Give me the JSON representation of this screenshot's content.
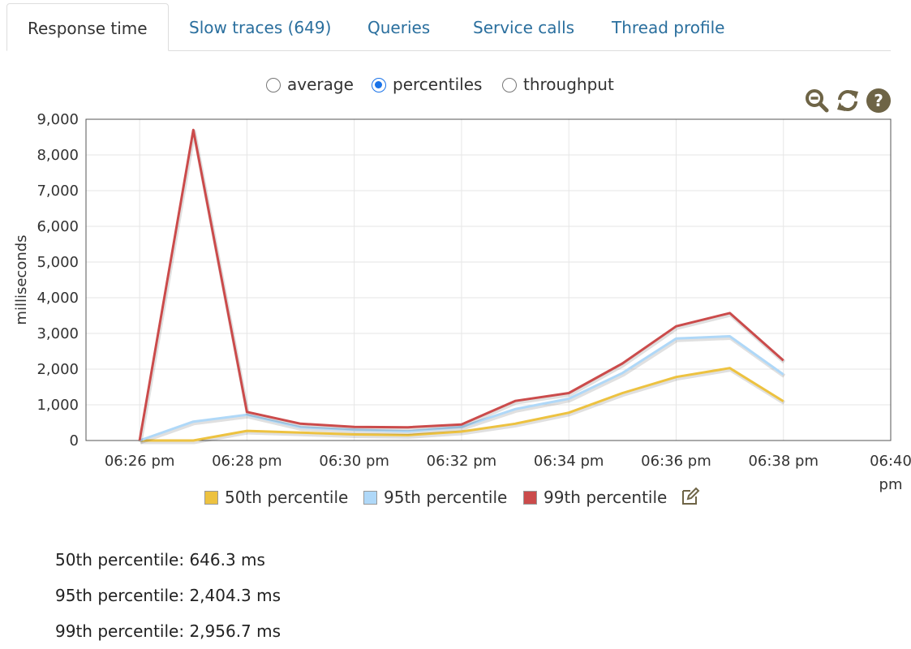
{
  "tabs": [
    {
      "label": "Response time",
      "active": true
    },
    {
      "label": "Slow traces (649)",
      "active": false
    },
    {
      "label": "Queries",
      "active": false
    },
    {
      "label": "Service calls",
      "active": false
    },
    {
      "label": "Thread profile",
      "active": false
    }
  ],
  "view_modes": {
    "options": [
      "average",
      "percentiles",
      "throughput"
    ],
    "selected": "percentiles"
  },
  "toolbar_icons": [
    "zoom-out-icon",
    "refresh-icon",
    "help-icon"
  ],
  "chart_data": {
    "type": "line",
    "title": "",
    "xlabel": "",
    "ylabel": "milliseconds",
    "x": [
      "06:26 pm",
      "06:27 pm",
      "06:28 pm",
      "06:29 pm",
      "06:30 pm",
      "06:31 pm",
      "06:32 pm",
      "06:33 pm",
      "06:34 pm",
      "06:35 pm",
      "06:36 pm",
      "06:37 pm",
      "06:38 pm"
    ],
    "x_ticks": [
      "06:26 pm",
      "06:28 pm",
      "06:30 pm",
      "06:32 pm",
      "06:34 pm",
      "06:36 pm",
      "06:38 pm",
      "06:40 pm"
    ],
    "xlim": [
      "06:25 pm",
      "06:40 pm"
    ],
    "ylim": [
      0,
      9000
    ],
    "y_ticks": [
      "0",
      "1,000",
      "2,000",
      "3,000",
      "4,000",
      "5,000",
      "6,000",
      "7,000",
      "8,000",
      "9,000"
    ],
    "grid": true,
    "legend_position": "bottom",
    "series": [
      {
        "name": "50th percentile",
        "color": "#edc240",
        "values": [
          0,
          0,
          270,
          220,
          170,
          150,
          250,
          470,
          780,
          1330,
          1780,
          2030,
          1100
        ]
      },
      {
        "name": "95th percentile",
        "color": "#afd8f8",
        "values": [
          0,
          530,
          720,
          370,
          300,
          260,
          380,
          880,
          1170,
          1890,
          2860,
          2920,
          1850
        ]
      },
      {
        "name": "99th percentile",
        "color": "#cb4b4b",
        "values": [
          0,
          8700,
          800,
          470,
          380,
          370,
          450,
          1110,
          1330,
          2160,
          3200,
          3570,
          2240
        ]
      }
    ]
  },
  "summary": [
    {
      "label": "50th percentile: 646.3 ms"
    },
    {
      "label": "95th percentile: 2,404.3 ms"
    },
    {
      "label": "99th percentile: 2,956.7 ms"
    }
  ],
  "colors": {
    "tab_link": "#2a6f9e",
    "icon": "#6e6446"
  }
}
